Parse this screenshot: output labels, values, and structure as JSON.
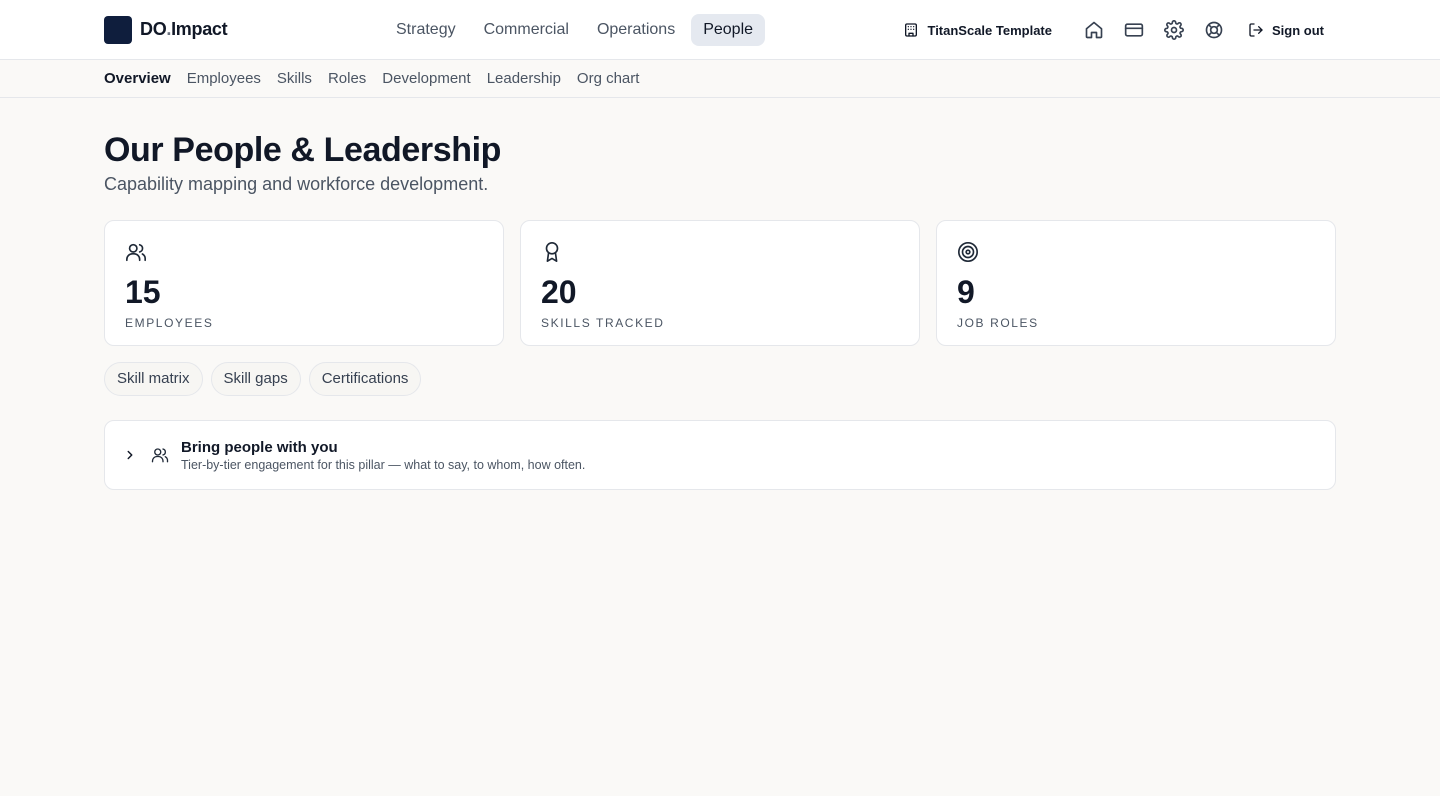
{
  "brand": {
    "name_a": "DO",
    "name_dot": ".",
    "name_b": "Impact"
  },
  "main_nav": [
    {
      "label": "Strategy"
    },
    {
      "label": "Commercial"
    },
    {
      "label": "Operations"
    },
    {
      "label": "People",
      "active": true
    }
  ],
  "header_right": {
    "org_name": "TitanScale Template",
    "icons": [
      "home-icon",
      "credit-card-icon",
      "gear-icon",
      "lifebuoy-icon"
    ],
    "sign_out_label": "Sign out"
  },
  "sub_nav": [
    {
      "label": "Overview",
      "active": true
    },
    {
      "label": "Employees"
    },
    {
      "label": "Skills"
    },
    {
      "label": "Roles"
    },
    {
      "label": "Development"
    },
    {
      "label": "Leadership"
    },
    {
      "label": "Org chart"
    }
  ],
  "page": {
    "title": "Our People & Leadership",
    "subtitle": "Capability mapping and workforce development."
  },
  "stats": [
    {
      "icon": "users-icon",
      "value": "15",
      "label": "Employees"
    },
    {
      "icon": "award-icon",
      "value": "20",
      "label": "Skills tracked"
    },
    {
      "icon": "target-icon",
      "value": "9",
      "label": "Job roles"
    }
  ],
  "pills": [
    {
      "label": "Skill matrix"
    },
    {
      "label": "Skill gaps"
    },
    {
      "label": "Certifications"
    }
  ],
  "panel": {
    "title": "Bring people with you",
    "description": "Tier-by-tier engagement for this pillar — what to say, to whom, how often."
  },
  "colors": {
    "brand_logo": "#0f1e3d",
    "active_nav_bg": "#e5e9f0",
    "page_bg": "#faf9f7"
  }
}
